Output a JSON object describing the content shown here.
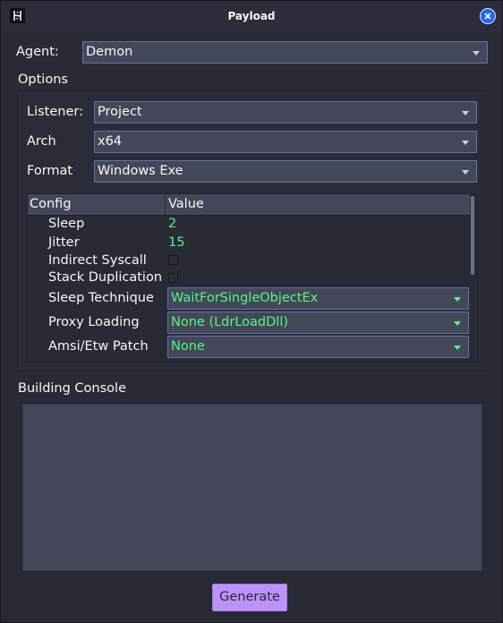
{
  "window": {
    "title": "Payload"
  },
  "icons": {
    "app": "havoc-logo-icon",
    "close": "close-icon",
    "dropdown": "chevron-down-icon"
  },
  "colors": {
    "background": "#282a36",
    "field": "#44475a",
    "accent_green": "#50fa7b",
    "button": "#bd93f9",
    "close": "#1e66f5"
  },
  "agent": {
    "label": "Agent:",
    "value": "Demon"
  },
  "options": {
    "title": "Options",
    "listener": {
      "label": "Listener:",
      "value": "Project"
    },
    "arch": {
      "label": "Arch",
      "value": "x64"
    },
    "format": {
      "label": "Format",
      "value": "Windows Exe"
    }
  },
  "config_table": {
    "headers": [
      "Config",
      "Value"
    ],
    "rows": {
      "sleep": {
        "label": "Sleep",
        "value": "2"
      },
      "jitter": {
        "label": "Jitter",
        "value": "15"
      },
      "indirect_syscall": {
        "label": "Indirect Syscall",
        "checked": false
      },
      "stack_duplication": {
        "label": "Stack Duplication",
        "checked": false
      },
      "sleep_technique": {
        "label": "Sleep Technique",
        "value": "WaitForSingleObjectEx"
      },
      "proxy_loading": {
        "label": "Proxy Loading",
        "value": "None (LdrLoadDll)"
      },
      "amsi_etw_patch": {
        "label": "Amsi/Etw Patch",
        "value": "None"
      }
    }
  },
  "console": {
    "title": "Building Console",
    "content": ""
  },
  "generate_button": {
    "label": "Generate"
  }
}
